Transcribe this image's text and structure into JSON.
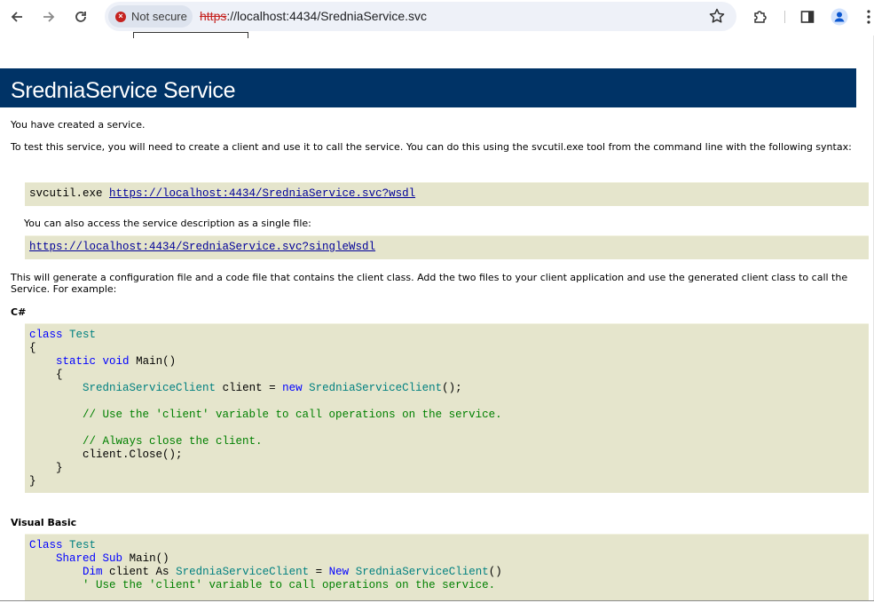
{
  "browser": {
    "security_label": "Not secure",
    "url_scheme": "https",
    "url_rest": "://localhost:4434/SredniaService.svc"
  },
  "page": {
    "title": "SredniaService Service",
    "intro": "You have created a service.",
    "test_text": "To test this service, you will need to create a client and use it to call the service. You can do this using the svcutil.exe tool from the command line with the following syntax:",
    "svcutil_cmd": "svcutil.exe ",
    "wsdl_link": "https://localhost:4434/SredniaService.svc?wsdl",
    "single_file_text": "You can also access the service description as a single file:",
    "single_wsdl_link": "https://localhost:4434/SredniaService.svc?singleWsdl",
    "generate_text": "This will generate a configuration file and a code file that contains the client class. Add the two files to your client application and use the generated client class to call the Service. For example:",
    "csharp_heading": "C#",
    "vb_heading": "Visual Basic",
    "csharp_code": {
      "l1_kw": "class",
      "l1_ty": "Test",
      "l2": "{",
      "l3_kw1": "static",
      "l3_kw2": "void",
      "l3_rest": "Main()",
      "l4": "{",
      "l5_ty": "SredniaServiceClient",
      "l5_mid": "client = ",
      "l5_kw": "new",
      "l5_ty2": "SredniaServiceClient",
      "l5_end": "();",
      "l6_cm": "// Use the 'client' variable to call operations on the service.",
      "l7_cm": "// Always close the client.",
      "l8": "client.Close();",
      "l9": "}",
      "l10": "}"
    },
    "vb_code": {
      "l1_kw": "Class",
      "l1_ty": "Test",
      "l2_kw1": "Shared",
      "l2_kw2": "Sub",
      "l2_rest": "Main()",
      "l3_kw": "Dim",
      "l3_mid": "client As",
      "l3_ty": "SredniaServiceClient",
      "l3_eq": "=",
      "l3_kw2": "New",
      "l3_ty2": "SredniaServiceClient",
      "l3_end": "()",
      "l4_cm": "' Use the 'client' variable to call operations on the service."
    }
  }
}
